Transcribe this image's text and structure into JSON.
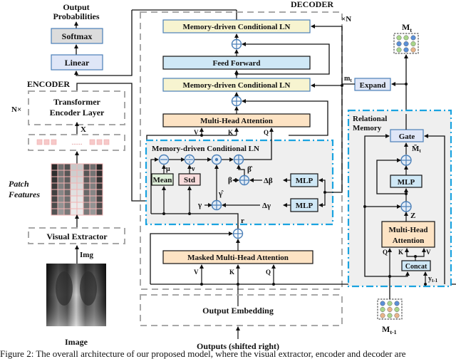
{
  "colors": {
    "yellow_box": "#f7f4d0",
    "blue_box": "#cfe8f6",
    "orange_box": "#fde3c4",
    "linear_box": "#dfe6f7",
    "softmax_box": "#dcdcdc",
    "mean_box": "#dff0da",
    "std_box": "#f8dcdc",
    "gray_dash": "#a8a8a8",
    "cyan_dash": "#1aa3e0",
    "op_stroke": "#4a7fb8",
    "region_fill": "#efefef",
    "dot_green": "#a8d58a",
    "dot_blue": "#5b8fd6",
    "dot_orange": "#e8b48a"
  },
  "output": {
    "title_line1": "Output",
    "title_line2": "Probabilities",
    "softmax": "Softmax",
    "linear": "Linear"
  },
  "encoder": {
    "title": "ENCODER",
    "repeat": "N×",
    "layer_line1": "Transformer",
    "layer_line2": "Encoder Layer",
    "x_label": "X",
    "ellipsis": "......",
    "patch_label_line1": "Patch",
    "patch_label_line2": "Features",
    "visual_extractor": "Visual Extractor",
    "img_label": "Img",
    "image_caption": "Image"
  },
  "decoder": {
    "title": "DECODER",
    "repeat": "×N",
    "mcln_top": "Memory-driven Conditional LN",
    "feed_forward": "Feed Forward",
    "mcln_mid": "Memory-driven Conditional LN",
    "mha": "Multi-Head Attention",
    "v": "V",
    "k": "K",
    "q": "Q",
    "masked_mha": "Masked Multi-Head Attention",
    "r_label": "r",
    "output_embedding": "Output Embedding",
    "outputs_shifted": "Outputs (shifted right)"
  },
  "mcln_detail": {
    "title": "Memory-driven Conditional LN",
    "mean": "Mean",
    "std": "Std",
    "mu": "μ",
    "nu": "ν",
    "beta": "β",
    "gamma": "γ",
    "beta_hat": "β̂",
    "gamma_hat": "γ̂",
    "t_sub": "t",
    "delta_beta": "Δβ",
    "delta_gamma": "Δγ",
    "mlp1": "MLP",
    "mlp2": "MLP",
    "minus": "−",
    "divide": "÷",
    "plus": "+"
  },
  "memory": {
    "mt_label": "M",
    "mt_sub": "t",
    "mtm1_sub": "t-1",
    "m_small": "m",
    "expand": "Expand",
    "title_line1": "Relational",
    "title_line2": "Memory",
    "gate": "Gate",
    "m_tilde": "M̃",
    "mlp": "MLP",
    "z": "Z",
    "mha_line1": "Multi-Head",
    "mha_line2": "Attention",
    "q": "Q",
    "k": "K",
    "v": "V",
    "concat": "Concat",
    "y": "y",
    "y_sub": "t-1",
    "mt_grid": [
      "green",
      "green",
      "blue",
      "blue",
      "blue",
      "green",
      "green",
      "blue",
      "orange"
    ],
    "mtm1_grid": [
      "blue",
      "green",
      "blue",
      "green",
      "orange",
      "green",
      "orange",
      "green",
      "orange"
    ]
  },
  "caption": "Figure 2: The overall architecture of our proposed model, where the visual extractor, encoder and decoder are"
}
